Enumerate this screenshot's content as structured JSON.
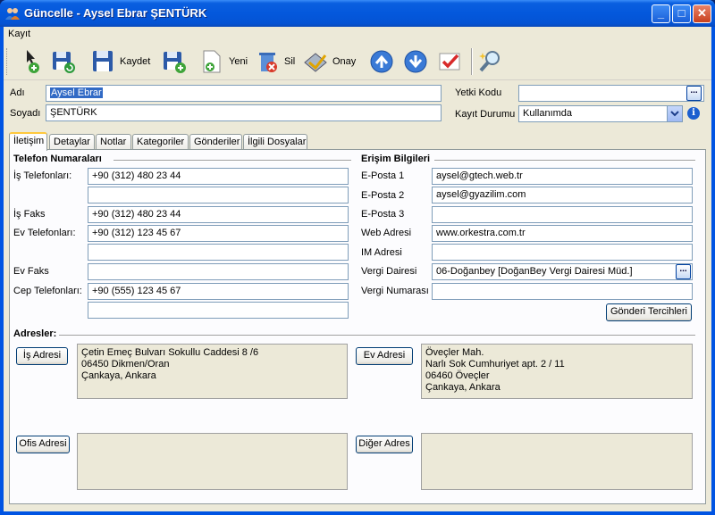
{
  "window": {
    "title": "Güncelle - Aysel Ebrar ŞENTÜRK"
  },
  "menu": {
    "items": [
      "Kayıt"
    ]
  },
  "toolbar": {
    "save_label": "Kaydet",
    "new_label": "Yeni",
    "delete_label": "Sil",
    "approve_label": "Onay"
  },
  "header": {
    "name_label": "Adı",
    "name_value": "Aysel Ebrar",
    "surname_label": "Soyadı",
    "surname_value": "ŞENTÜRK",
    "authority_label": "Yetki Kodu",
    "authority_value": "",
    "status_label": "Kayıt Durumu",
    "status_value": "Kullanımda"
  },
  "tabs": [
    "İletişim",
    "Detaylar",
    "Notlar",
    "Kategoriler",
    "Gönderiler",
    "İlgili Dosyalar"
  ],
  "phones": {
    "title": "Telefon Numaraları",
    "work_label": "İş Telefonları:",
    "work_1": "+90 (312) 480 23 44",
    "work_2": "",
    "fax_label": "İş Faks",
    "fax": "+90 (312) 480 23 44",
    "home_label": "Ev Telefonları:",
    "home_1": "+90 (312) 123 45 67",
    "home_2": "",
    "home_fax_label": "Ev Faks",
    "home_fax": "",
    "mobile_label": "Cep Telefonları:",
    "mobile_1": "+90 (555) 123 45 67",
    "mobile_2": ""
  },
  "access": {
    "title": "Erişim Bilgileri",
    "email1_label": "E-Posta 1",
    "email1": "aysel@gtech.web.tr",
    "email2_label": "E-Posta 2",
    "email2": "aysel@gyazilim.com",
    "email3_label": "E-Posta 3",
    "email3": "",
    "web_label": "Web Adresi",
    "web": "www.orkestra.com.tr",
    "im_label": "IM Adresi",
    "im": "",
    "tax_office_label": "Vergi Dairesi",
    "tax_office": "06-Doğanbey [DoğanBey Vergi Dairesi Müd.]",
    "tax_number_label": "Vergi Numarası",
    "tax_number": "",
    "shipping_button": "Gönderi Tercihleri"
  },
  "addresses": {
    "title": "Adresler:",
    "work_button": "İş Adresi",
    "work_lines": [
      "Çetin Emeç Bulvarı Sokullu Caddesi 8 /6",
      "06450 Dikmen/Oran",
      "Çankaya, Ankara"
    ],
    "home_button": "Ev Adresi",
    "home_lines": [
      "Öveçler Mah.",
      "Narlı Sok Cumhuriyet apt. 2 / 11",
      "06460 Öveçler",
      "Çankaya, Ankara"
    ],
    "office_button": "Ofis Adresi",
    "other_button": "Diğer Adres"
  },
  "icons": [
    "people-icon",
    "add-record-icon",
    "save-refresh-icon",
    "save-icon",
    "save-new-icon",
    "new-document-icon",
    "delete-icon",
    "approve-icon",
    "up-arrow-icon",
    "down-arrow-icon",
    "checklist-icon",
    "search-icon",
    "info-icon",
    "ellipsis-icon",
    "dropdown-arrow-icon"
  ]
}
